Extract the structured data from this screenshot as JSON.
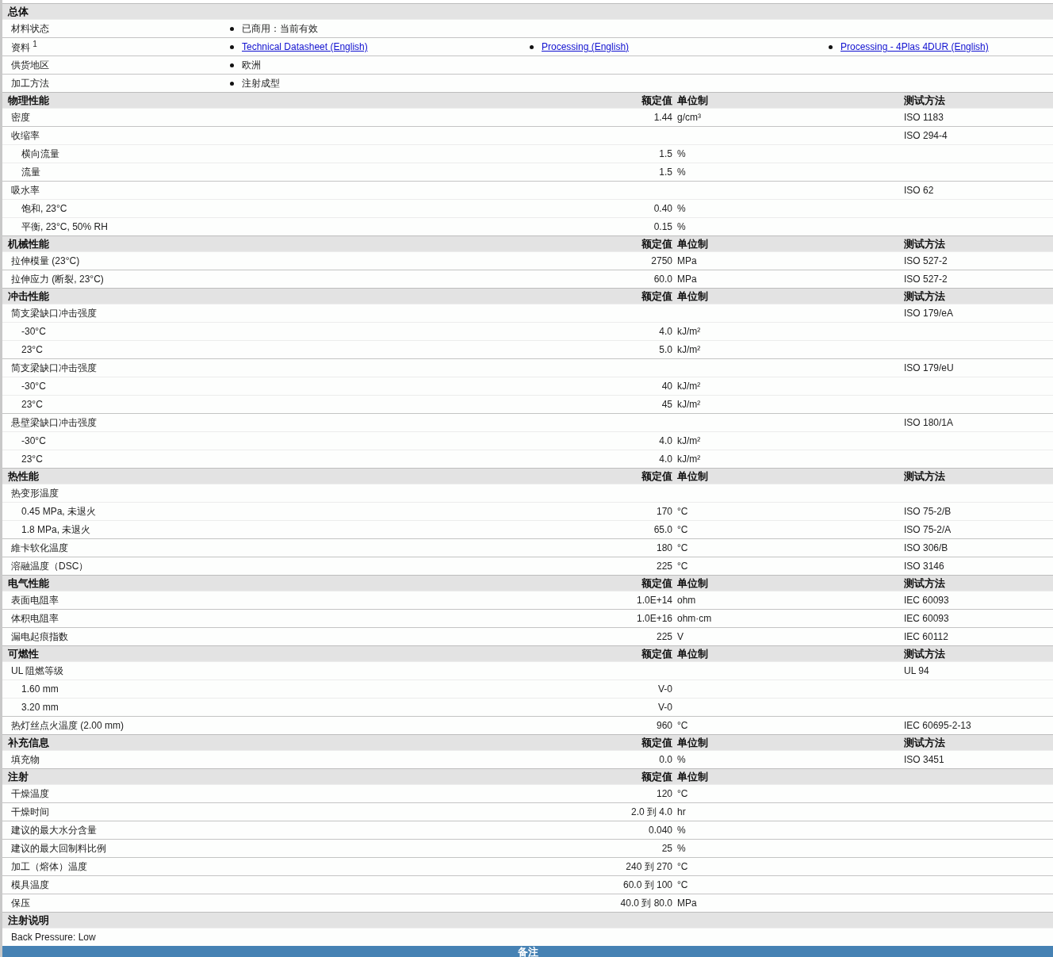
{
  "sections": [
    {
      "title": "总体",
      "kind": "bullets",
      "rows": [
        {
          "label": "材料状态",
          "items": [
            {
              "text": "已商用：当前有效",
              "link": false
            }
          ]
        },
        {
          "label": "资料 $^{1}$",
          "items": [
            {
              "text": "Technical Datasheet (English)",
              "link": true
            },
            {
              "text": "Processing (English)",
              "link": true
            },
            {
              "text": "Processing - 4Plas 4DUR (English)",
              "link": true
            }
          ]
        },
        {
          "label": "供货地区",
          "items": [
            {
              "text": "欧洲",
              "link": false
            }
          ]
        },
        {
          "label": "加工方法",
          "items": [
            {
              "text": "注射成型",
              "link": false
            }
          ]
        }
      ]
    },
    {
      "title": "物理性能",
      "kind": "table",
      "value_heading": "额定值",
      "unit_heading": "单位制",
      "method_heading": "测试方法",
      "rows": [
        {
          "label": "密度",
          "value": "1.44",
          "unit": "g/cm³",
          "method": "ISO 1183"
        },
        {
          "label": "收缩率",
          "method": "ISO 294-4",
          "children": [
            {
              "label": "横向流量",
              "value": "1.5",
              "unit": "%"
            },
            {
              "label": "流量",
              "value": "1.5",
              "unit": "%"
            }
          ]
        },
        {
          "label": "吸水率",
          "method": "ISO 62",
          "children": [
            {
              "label": "饱和, 23°C",
              "value": "0.40",
              "unit": "%"
            },
            {
              "label": "平衡, 23°C, 50% RH",
              "value": "0.15",
              "unit": "%"
            }
          ]
        }
      ]
    },
    {
      "title": "机械性能",
      "kind": "table",
      "value_heading": "额定值",
      "unit_heading": "单位制",
      "method_heading": "测试方法",
      "rows": [
        {
          "label": "拉伸模量 (23°C)",
          "value": "2750",
          "unit": "MPa",
          "method": "ISO 527-2"
        },
        {
          "label": "拉伸应力 (断裂, 23°C)",
          "value": "60.0",
          "unit": "MPa",
          "method": "ISO 527-2"
        }
      ]
    },
    {
      "title": "冲击性能",
      "kind": "table",
      "value_heading": "额定值",
      "unit_heading": "单位制",
      "method_heading": "测试方法",
      "rows": [
        {
          "label": "简支梁缺口冲击强度",
          "method": "ISO 179/eA",
          "children": [
            {
              "label": "-30°C",
              "value": "4.0",
              "unit": "kJ/m²"
            },
            {
              "label": "23°C",
              "value": "5.0",
              "unit": "kJ/m²"
            }
          ]
        },
        {
          "label": "简支梁缺口冲击强度",
          "method": "ISO 179/eU",
          "children": [
            {
              "label": "-30°C",
              "value": "40",
              "unit": "kJ/m²"
            },
            {
              "label": "23°C",
              "value": "45",
              "unit": "kJ/m²"
            }
          ]
        },
        {
          "label": "悬壁梁缺口冲击强度",
          "method": "ISO 180/1A",
          "children": [
            {
              "label": "-30°C",
              "value": "4.0",
              "unit": "kJ/m²"
            },
            {
              "label": "23°C",
              "value": "4.0",
              "unit": "kJ/m²"
            }
          ]
        }
      ]
    },
    {
      "title": "热性能",
      "kind": "table",
      "value_heading": "额定值",
      "unit_heading": "单位制",
      "method_heading": "测试方法",
      "rows": [
        {
          "label": "热变形温度",
          "children": [
            {
              "label": "0.45 MPa, 未退火",
              "value": "170",
              "unit": "°C",
              "method": "ISO 75-2/B"
            },
            {
              "label": "1.8 MPa, 未退火",
              "value": "65.0",
              "unit": "°C",
              "method": "ISO 75-2/A"
            }
          ]
        },
        {
          "label": "維卡软化温度",
          "value": "180",
          "unit": "°C",
          "method": "ISO 306/B"
        },
        {
          "label": "溶融温度（DSC）",
          "value": "225",
          "unit": "°C",
          "method": "ISO 3146"
        }
      ]
    },
    {
      "title": "电气性能",
      "kind": "table",
      "value_heading": "额定值",
      "unit_heading": "单位制",
      "method_heading": "测试方法",
      "rows": [
        {
          "label": "表面电阻率",
          "value": "1.0E+14",
          "unit": "ohm",
          "method": "IEC 60093"
        },
        {
          "label": "体积电阻率",
          "value": "1.0E+16",
          "unit": "ohm·cm",
          "method": "IEC 60093"
        },
        {
          "label": "漏电起痕指数",
          "value": "225",
          "unit": "V",
          "method": "IEC 60112"
        }
      ]
    },
    {
      "title": "可燃性",
      "kind": "table",
      "value_heading": "额定值",
      "unit_heading": "单位制",
      "method_heading": "测试方法",
      "rows": [
        {
          "label": "UL 阻燃等级",
          "method": "UL 94",
          "children": [
            {
              "label": "1.60 mm",
              "value": "V-0"
            },
            {
              "label": "3.20 mm",
              "value": "V-0"
            }
          ]
        },
        {
          "label": "热灯丝点火温度 (2.00 mm)",
          "value": "960",
          "unit": "°C",
          "method": "IEC 60695-2-13"
        }
      ]
    },
    {
      "title": "补充信息",
      "kind": "table",
      "value_heading": "额定值",
      "unit_heading": "单位制",
      "method_heading": "测试方法",
      "rows": [
        {
          "label": "填充物",
          "value": "0.0",
          "unit": "%",
          "method": "ISO 3451"
        }
      ]
    },
    {
      "title": "注射",
      "kind": "table",
      "value_heading": "额定值",
      "unit_heading": "单位制",
      "rows": [
        {
          "label": "干燥温度",
          "value": "120",
          "unit": "°C"
        },
        {
          "label": "干燥时间",
          "value": "2.0 到  4.0",
          "unit": "hr"
        },
        {
          "label": "建议的最大水分含量",
          "value": "0.040",
          "unit": "%"
        },
        {
          "label": "建议的最大回制料比例",
          "value": "25",
          "unit": "%"
        },
        {
          "label": "加工（熔体）温度",
          "value": "240 到  270",
          "unit": "°C"
        },
        {
          "label": "模具温度",
          "value": "60.0 到  100",
          "unit": "°C"
        },
        {
          "label": "保压",
          "value": "40.0 到  80.0",
          "unit": "MPa"
        }
      ]
    },
    {
      "title": "注射说明",
      "kind": "note",
      "rows": [
        {
          "label": "Back Pressure: Low"
        }
      ]
    }
  ],
  "footer": {
    "title": "备注"
  }
}
